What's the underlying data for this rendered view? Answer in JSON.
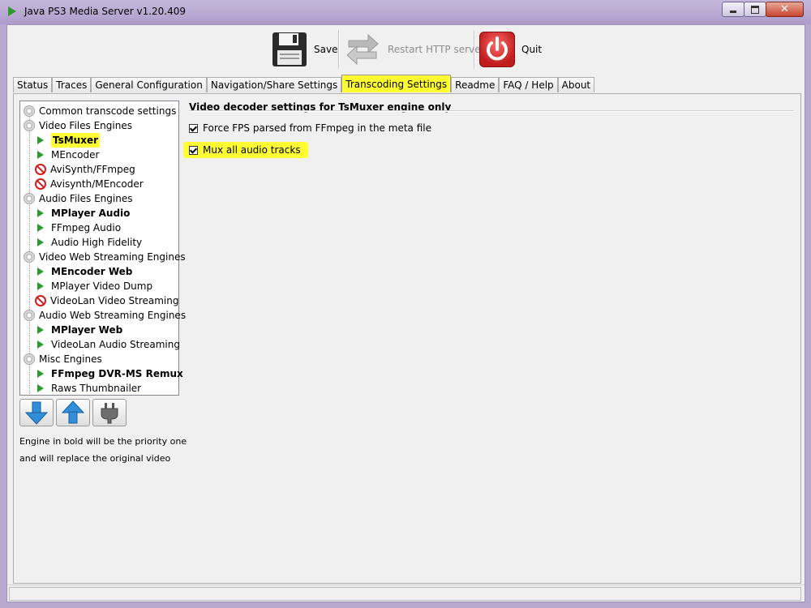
{
  "window": {
    "title": "Java PS3 Media Server v1.20.409",
    "close_glyph": "✕"
  },
  "toolbar": {
    "save_label": "Save",
    "restart_label": "Restart HTTP server",
    "quit_label": "Quit"
  },
  "tabs": [
    {
      "label": "Status"
    },
    {
      "label": "Traces"
    },
    {
      "label": "General Configuration"
    },
    {
      "label": "Navigation/Share Settings"
    },
    {
      "label": "Transcoding Settings"
    },
    {
      "label": "Readme"
    },
    {
      "label": "FAQ / Help"
    },
    {
      "label": "About"
    }
  ],
  "active_tab": "Transcoding Settings",
  "tree": {
    "items": [
      {
        "label": "Common transcode settings",
        "icon": "gear-icon"
      },
      {
        "label": "Video Files Engines",
        "icon": "gear-icon"
      },
      {
        "label": "TsMuxer",
        "icon": "play-icon"
      },
      {
        "label": "MEncoder",
        "icon": "play-icon"
      },
      {
        "label": "AviSynth/FFmpeg",
        "icon": "no-entry-icon"
      },
      {
        "label": "Avisynth/MEncoder",
        "icon": "no-entry-icon"
      },
      {
        "label": "Audio Files Engines",
        "icon": "gear-icon"
      },
      {
        "label": "MPlayer Audio",
        "icon": "play-icon"
      },
      {
        "label": "FFmpeg Audio",
        "icon": "play-icon"
      },
      {
        "label": "Audio High Fidelity",
        "icon": "play-icon"
      },
      {
        "label": "Video Web Streaming Engines",
        "icon": "gear-icon"
      },
      {
        "label": "MEncoder Web",
        "icon": "play-icon"
      },
      {
        "label": "MPlayer Video Dump",
        "icon": "play-icon"
      },
      {
        "label": "VideoLan Video Streaming",
        "icon": "no-entry-icon"
      },
      {
        "label": "Audio Web Streaming Engines",
        "icon": "gear-icon"
      },
      {
        "label": "MPlayer Web",
        "icon": "play-icon"
      },
      {
        "label": "VideoLan Audio Streaming",
        "icon": "play-icon"
      },
      {
        "label": "Misc Engines",
        "icon": "gear-icon"
      },
      {
        "label": "FFmpeg DVR-MS Remux",
        "icon": "play-icon"
      },
      {
        "label": "Raws Thumbnailer",
        "icon": "play-icon"
      }
    ],
    "selected": "TsMuxer"
  },
  "buttons": {
    "move_down": "arrow-down-icon",
    "move_up": "arrow-up-icon",
    "toggle_engine": "plug-icon"
  },
  "hint": {
    "line1": "Engine in bold will be the priority one",
    "line2": "and will replace the original video"
  },
  "settings": {
    "section_title": "Video decoder settings for TsMuxer engine only",
    "force_fps_label": "Force FPS parsed from FFmpeg in the meta file",
    "force_fps_checked": true,
    "mux_audio_label": "Mux all audio tracks",
    "mux_audio_checked": true
  },
  "colors": {
    "highlight": "#ffff33",
    "play_green": "#2e9a2e",
    "stop_red": "#d01d1d"
  }
}
